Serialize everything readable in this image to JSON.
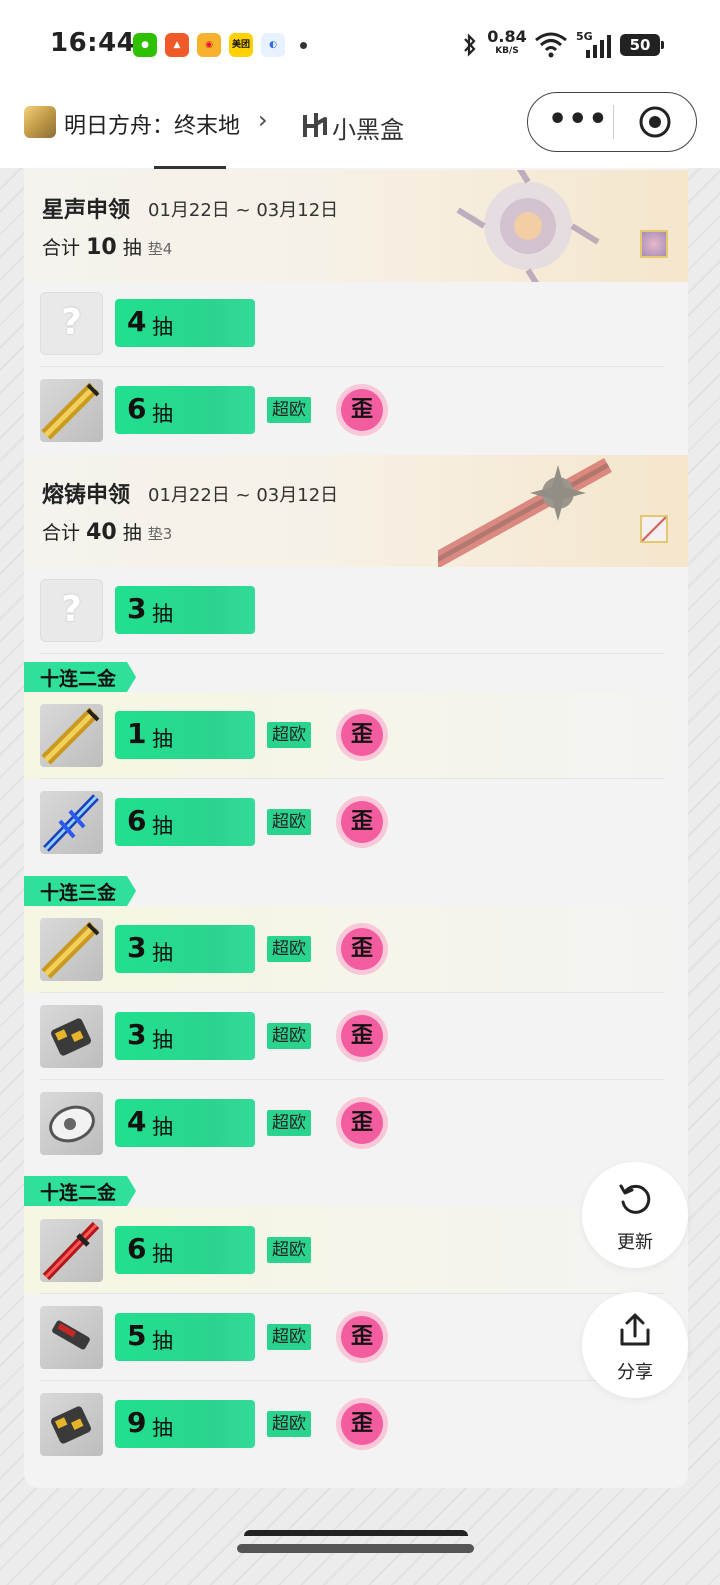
{
  "status_bar": {
    "time": "16:44",
    "net_speed_value": "0.84",
    "net_speed_unit": "KB/S",
    "signal_label": "5G",
    "battery": "50",
    "app_icons": [
      "wechat-icon",
      "orange-app-icon",
      "weibo-icon",
      "meituan-icon",
      "browser-icon"
    ],
    "meituan_text": "美团"
  },
  "header": {
    "game_title": "明日方舟：终末地",
    "brand_name": "小黑盒"
  },
  "banners": [
    {
      "title": "星声申领",
      "date": "01月22日 ~ 03月12日",
      "total_prefix": "合计",
      "total_count": "10",
      "total_unit": "抽",
      "pity": "垫4"
    },
    {
      "title": "熔铸申领",
      "date": "01月22日 ~ 03月12日",
      "total_prefix": "合计",
      "total_count": "40",
      "total_unit": "抽",
      "pity": "垫3"
    }
  ],
  "labels": {
    "unit": "抽",
    "super_lucky": "超欧",
    "wai": "歪"
  },
  "ten_pull_labels": [
    "十连二金",
    "十连三金",
    "十连二金"
  ],
  "rows": [
    {
      "count": "4",
      "icon": "unknown",
      "super_lucky": false,
      "wai": false
    },
    {
      "count": "6",
      "icon": "gold-cannon",
      "super_lucky": true,
      "wai": true
    },
    {
      "count": "3",
      "icon": "unknown",
      "super_lucky": false,
      "wai": false
    },
    {
      "count": "1",
      "icon": "gold-cannon",
      "super_lucky": true,
      "wai": true
    },
    {
      "count": "6",
      "icon": "blue-sword",
      "super_lucky": true,
      "wai": true
    },
    {
      "count": "3",
      "icon": "gold-cannon",
      "super_lucky": true,
      "wai": true
    },
    {
      "count": "3",
      "icon": "gauntlet",
      "super_lucky": true,
      "wai": true
    },
    {
      "count": "4",
      "icon": "silver-arm",
      "super_lucky": true,
      "wai": true
    },
    {
      "count": "6",
      "icon": "red-sword",
      "super_lucky": true,
      "wai": false
    },
    {
      "count": "5",
      "icon": "red-gun",
      "super_lucky": true,
      "wai": true
    },
    {
      "count": "9",
      "icon": "gauntlet",
      "super_lucky": true,
      "wai": true
    }
  ],
  "fab": {
    "refresh_label": "更新",
    "share_label": "分享"
  },
  "colors": {
    "accent_green": "#2bd48e",
    "wai_pink": "#f45ca0",
    "highlight_yellow": "#f6f6e2"
  }
}
